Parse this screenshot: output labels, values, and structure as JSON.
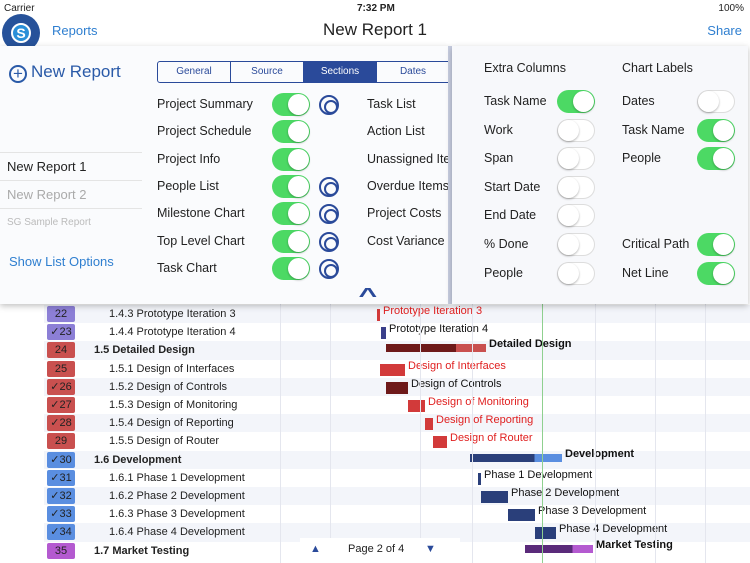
{
  "status": {
    "carrier": "Carrier",
    "time": "7:32 PM",
    "battery": "100%"
  },
  "nav": {
    "back": "Reports",
    "title": "New Report 1",
    "share": "Share"
  },
  "sidebar": {
    "new_report": "New Report",
    "reports": [
      "New Report 1",
      "New Report 2",
      "SG Sample Report"
    ],
    "show_options": "Show List Options"
  },
  "tabs": [
    {
      "label": "General",
      "active": false
    },
    {
      "label": "Source",
      "active": false
    },
    {
      "label": "Sections",
      "active": true
    },
    {
      "label": "Dates",
      "active": false
    }
  ],
  "sections": [
    {
      "label": "Project Summary",
      "on": true,
      "gear": true
    },
    {
      "label": "Project Schedule",
      "on": true,
      "gear": false
    },
    {
      "label": "Project Info",
      "on": true,
      "gear": false
    },
    {
      "label": "People List",
      "on": true,
      "gear": true
    },
    {
      "label": "Milestone Chart",
      "on": true,
      "gear": true
    },
    {
      "label": "Top Level Chart",
      "on": true,
      "gear": true
    },
    {
      "label": "Task Chart",
      "on": true,
      "gear": true
    }
  ],
  "sections2": [
    "Task List",
    "Action List",
    "Unassigned Iten",
    "Overdue Items",
    "Project Costs",
    "Cost Variance"
  ],
  "extra_columns": {
    "title": "Extra Columns",
    "items": [
      {
        "label": "Task Name",
        "on": true
      },
      {
        "label": "Work",
        "on": false
      },
      {
        "label": "Span",
        "on": false
      },
      {
        "label": "Start Date",
        "on": false
      },
      {
        "label": "End Date",
        "on": false
      },
      {
        "label": "% Done",
        "on": false
      },
      {
        "label": "People",
        "on": false
      }
    ]
  },
  "chart_labels": {
    "title": "Chart Labels",
    "items": [
      {
        "label": "Dates",
        "on": false
      },
      {
        "label": "Task Name",
        "on": true
      },
      {
        "label": "People",
        "on": true
      },
      {
        "label": "Critical Path",
        "on": true
      },
      {
        "label": "Net Line",
        "on": true
      }
    ]
  },
  "gantt": {
    "rows": [
      {
        "id": "22",
        "done": false,
        "name": "1.4.3 Prototype Iteration 3",
        "bold": false,
        "color": "#8c7fd6",
        "bar_label": "Prototype Iteration 3",
        "critical": true
      },
      {
        "id": "23",
        "done": true,
        "name": "1.4.4 Prototype Iteration 4",
        "bold": false,
        "color": "#8c7fd6",
        "bar_label": "Prototype Iteration 4",
        "critical": false
      },
      {
        "id": "24",
        "done": false,
        "name": "1.5 Detailed Design",
        "bold": true,
        "color": "#c9504f",
        "bar_label": "Detailed Design",
        "critical": false
      },
      {
        "id": "25",
        "done": false,
        "name": "1.5.1 Design of Interfaces",
        "bold": false,
        "color": "#c9504f",
        "bar_label": "Design of Interfaces",
        "critical": true
      },
      {
        "id": "26",
        "done": true,
        "name": "1.5.2 Design of Controls",
        "bold": false,
        "color": "#c9504f",
        "bar_label": "Design of Controls",
        "critical": false
      },
      {
        "id": "27",
        "done": true,
        "name": "1.5.3 Design of Monitoring",
        "bold": false,
        "color": "#c9504f",
        "bar_label": "Design of Monitoring",
        "critical": true
      },
      {
        "id": "28",
        "done": true,
        "name": "1.5.4 Design of Reporting",
        "bold": false,
        "color": "#c9504f",
        "bar_label": "Design of Reporting",
        "critical": true
      },
      {
        "id": "29",
        "done": false,
        "name": "1.5.5 Design of Router",
        "bold": false,
        "color": "#c9504f",
        "bar_label": "Design of Router",
        "critical": true
      },
      {
        "id": "30",
        "done": true,
        "name": "1.6 Development",
        "bold": true,
        "color": "#5a8ee0",
        "bar_label": "Development",
        "critical": false
      },
      {
        "id": "31",
        "done": true,
        "name": "1.6.1 Phase 1 Development",
        "bold": false,
        "color": "#5a8ee0",
        "bar_label": "Phase 1 Development",
        "critical": false
      },
      {
        "id": "32",
        "done": true,
        "name": "1.6.2 Phase 2 Development",
        "bold": false,
        "color": "#5a8ee0",
        "bar_label": "Phase 2 Development",
        "critical": false
      },
      {
        "id": "33",
        "done": true,
        "name": "1.6.3 Phase 3 Development",
        "bold": false,
        "color": "#5a8ee0",
        "bar_label": "Phase 3 Development",
        "critical": false
      },
      {
        "id": "34",
        "done": true,
        "name": "1.6.4 Phase 4 Development",
        "bold": false,
        "color": "#5a8ee0",
        "bar_label": "Phase 4 Development",
        "critical": false
      },
      {
        "id": "35",
        "done": false,
        "name": "1.7 Market Testing",
        "bold": true,
        "color": "#b45ad0",
        "bar_label": "Market Testing",
        "critical": false
      }
    ]
  },
  "pager": {
    "label": "Page 2 of 4"
  }
}
